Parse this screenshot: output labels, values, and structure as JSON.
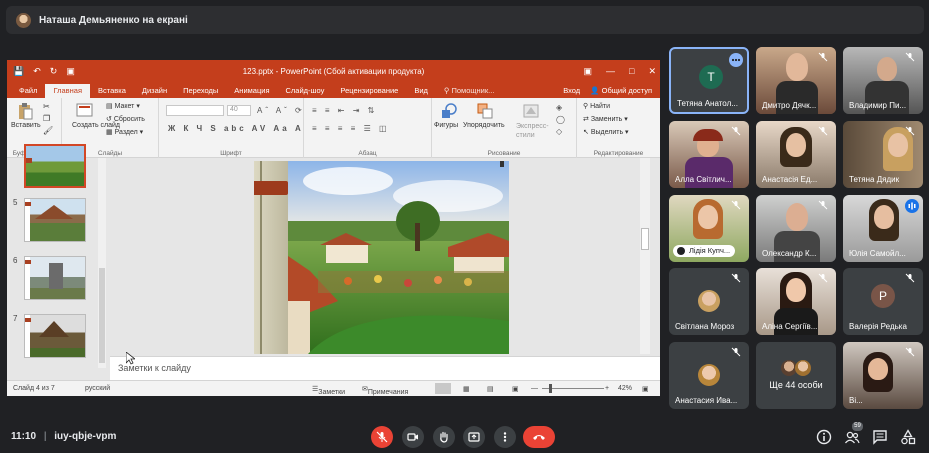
{
  "presenter_bar": {
    "text": "Наташа Демьяненко на екрані"
  },
  "powerpoint": {
    "title": "123.pptx - PowerPoint (Сбой активации продукта)",
    "tabs": [
      "Файл",
      "Главная",
      "Вставка",
      "Дизайн",
      "Переходы",
      "Анимация",
      "Слайд-шоу",
      "Рецензирование",
      "Вид"
    ],
    "tell_me": "Помощник...",
    "login": "Вход",
    "share": "Общий доступ",
    "ribbon": {
      "paste": "Вставить",
      "create_slide": "Создать слайд",
      "layout": "Макет",
      "reset": "Сбросить",
      "section": "Раздел",
      "font_size": "40",
      "shapes": "Фигуры",
      "arrange": "Упорядочить",
      "express_styles": "Экспресс-стили",
      "find": "Найти",
      "replace": "Заменить",
      "select": "Выделить",
      "groups": {
        "clipboard": "Буфер обме...",
        "slides": "Слайды",
        "font": "Шрифт",
        "paragraph": "Абзац",
        "drawing": "Рисование",
        "editing": "Редактирование"
      }
    },
    "thumbnails": [
      "5",
      "6",
      "7"
    ],
    "notes_placeholder": "Заметки к слайду",
    "status": {
      "slide_info": "Слайд 4 из 7",
      "language": "русский",
      "notes": "Заметки",
      "comments": "Примечания",
      "zoom": "42%"
    }
  },
  "participants": [
    {
      "name": "Тетяна Анатол...",
      "initial": "Т"
    },
    {
      "name": "Дмитро Дячк..."
    },
    {
      "name": "Владимир Пи..."
    },
    {
      "name": "Алла Світлич..."
    },
    {
      "name": "Анастасія Ед..."
    },
    {
      "name": "Тетяна Дядик"
    },
    {
      "name": "Лідія Купч..."
    },
    {
      "name": "Олександр К..."
    },
    {
      "name": "Юлія Самойл..."
    },
    {
      "name": "Світлана Мороз"
    },
    {
      "name": "Аліна Сергіїв..."
    },
    {
      "name": "Валерія Редька",
      "initial": "Р"
    },
    {
      "name": "Анастасия Ива..."
    },
    {
      "name": "Ще 44 особи"
    },
    {
      "name": "Ві..."
    }
  ],
  "bottom_bar": {
    "time": "11:10",
    "meeting_code": "iuy-qbje-vpm",
    "participant_count": "59"
  }
}
